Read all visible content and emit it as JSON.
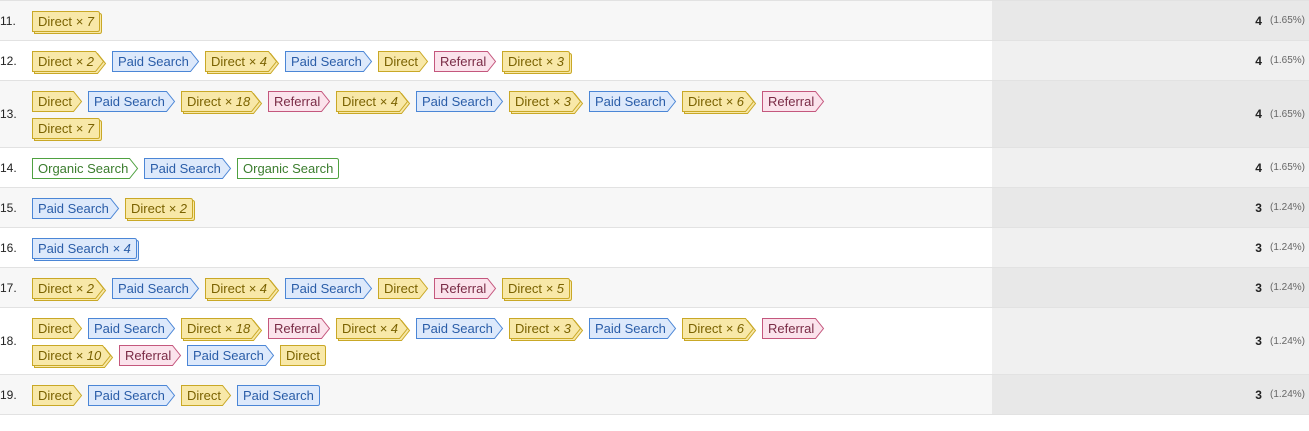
{
  "colors": {
    "Direct": {
      "fill": "#f8e8a8",
      "stroke": "#c9a826",
      "text": "#7a6200"
    },
    "Paid Search": {
      "fill": "#dde9fb",
      "stroke": "#4b86d6",
      "text": "#2a5da8"
    },
    "Referral": {
      "fill": "#fbe3ec",
      "stroke": "#c4577d",
      "text": "#7a2b46"
    },
    "Organic Search": {
      "fill": "#ffffff",
      "stroke": "#4fa140",
      "text": "#3b7d2e"
    }
  },
  "rows": [
    {
      "index": "11.",
      "value": "4",
      "pct": "(1.65%)",
      "lines": [
        [
          {
            "ch": "Direct",
            "x": "× 7"
          }
        ]
      ]
    },
    {
      "index": "12.",
      "value": "4",
      "pct": "(1.65%)",
      "lines": [
        [
          {
            "ch": "Direct",
            "x": "× 2"
          },
          {
            "ch": "Paid Search"
          },
          {
            "ch": "Direct",
            "x": "× 4"
          },
          {
            "ch": "Paid Search"
          },
          {
            "ch": "Direct"
          },
          {
            "ch": "Referral"
          },
          {
            "ch": "Direct",
            "x": "× 3"
          }
        ]
      ]
    },
    {
      "index": "13.",
      "value": "4",
      "pct": "(1.65%)",
      "lines": [
        [
          {
            "ch": "Direct"
          },
          {
            "ch": "Paid Search"
          },
          {
            "ch": "Direct",
            "x": "× 18"
          },
          {
            "ch": "Referral"
          },
          {
            "ch": "Direct",
            "x": "× 4"
          },
          {
            "ch": "Paid Search"
          },
          {
            "ch": "Direct",
            "x": "× 3"
          },
          {
            "ch": "Paid Search"
          },
          {
            "ch": "Direct",
            "x": "× 6"
          },
          {
            "ch": "Referral"
          }
        ],
        [
          {
            "ch": "Direct",
            "x": "× 7"
          }
        ]
      ]
    },
    {
      "index": "14.",
      "value": "4",
      "pct": "(1.65%)",
      "lines": [
        [
          {
            "ch": "Organic Search"
          },
          {
            "ch": "Paid Search"
          },
          {
            "ch": "Organic Search"
          }
        ]
      ]
    },
    {
      "index": "15.",
      "value": "3",
      "pct": "(1.24%)",
      "lines": [
        [
          {
            "ch": "Paid Search"
          },
          {
            "ch": "Direct",
            "x": "× 2"
          }
        ]
      ]
    },
    {
      "index": "16.",
      "value": "3",
      "pct": "(1.24%)",
      "lines": [
        [
          {
            "ch": "Paid Search",
            "x": "× 4"
          }
        ]
      ]
    },
    {
      "index": "17.",
      "value": "3",
      "pct": "(1.24%)",
      "lines": [
        [
          {
            "ch": "Direct",
            "x": "× 2"
          },
          {
            "ch": "Paid Search"
          },
          {
            "ch": "Direct",
            "x": "× 4"
          },
          {
            "ch": "Paid Search"
          },
          {
            "ch": "Direct"
          },
          {
            "ch": "Referral"
          },
          {
            "ch": "Direct",
            "x": "× 5"
          }
        ]
      ]
    },
    {
      "index": "18.",
      "value": "3",
      "pct": "(1.24%)",
      "lines": [
        [
          {
            "ch": "Direct"
          },
          {
            "ch": "Paid Search"
          },
          {
            "ch": "Direct",
            "x": "× 18"
          },
          {
            "ch": "Referral"
          },
          {
            "ch": "Direct",
            "x": "× 4"
          },
          {
            "ch": "Paid Search"
          },
          {
            "ch": "Direct",
            "x": "× 3"
          },
          {
            "ch": "Paid Search"
          },
          {
            "ch": "Direct",
            "x": "× 6"
          },
          {
            "ch": "Referral"
          }
        ],
        [
          {
            "ch": "Direct",
            "x": "× 10"
          },
          {
            "ch": "Referral"
          },
          {
            "ch": "Paid Search"
          },
          {
            "ch": "Direct"
          }
        ]
      ]
    },
    {
      "index": "19.",
      "value": "3",
      "pct": "(1.24%)",
      "lines": [
        [
          {
            "ch": "Direct"
          },
          {
            "ch": "Paid Search"
          },
          {
            "ch": "Direct"
          },
          {
            "ch": "Paid Search"
          }
        ]
      ]
    }
  ]
}
